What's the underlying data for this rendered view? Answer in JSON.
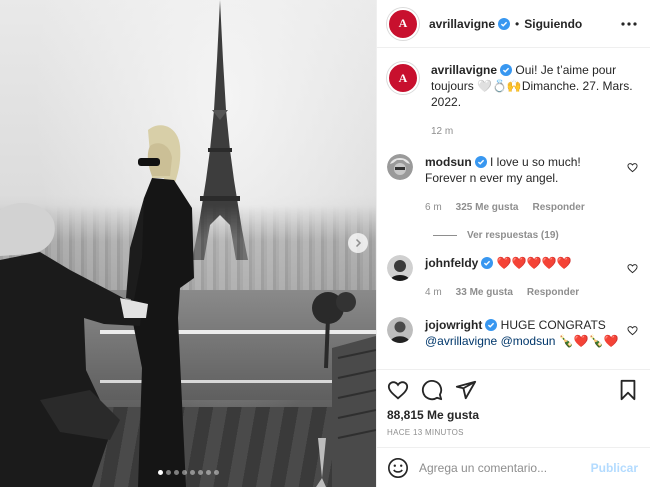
{
  "post": {
    "author": "avrillavigne",
    "follow_state": "Siguiendo",
    "separator": "•",
    "brand_color": "#c8102e",
    "link_color": "#00376b",
    "photo_count": 8,
    "active_photo": 1
  },
  "caption": {
    "username": "avrillavigne",
    "text": "Oui! Je t’aime pour toujours 🤍💍🙌Dimanche. 27. Mars. 2022.",
    "time": "12 m"
  },
  "comments": [
    {
      "username": "modsun",
      "text": "I love u so much! Forever n ever my angel.",
      "time": "6 m",
      "likes": "325 Me gusta",
      "reply": "Responder",
      "view_replies": "Ver respuestas (19)"
    },
    {
      "username": "johnfeldy",
      "text": "❤️❤️❤️❤️❤️",
      "time": "4 m",
      "likes": "33 Me gusta",
      "reply": "Responder"
    },
    {
      "username": "jojowright",
      "text": "HUGE CONGRATS",
      "mention1": "@avrillavigne",
      "mention2": "@modsun",
      "emoji": "🍾❤️🍾❤️"
    }
  ],
  "footer": {
    "likes": "88,815 Me gusta",
    "time_ago": "HACE 13 MINUTOS",
    "comment_placeholder": "Agrega un comentario...",
    "publish_label": "Publicar"
  },
  "icons": {
    "more": "more-options-icon",
    "like": "heart-icon",
    "comment": "comment-icon",
    "share": "share-icon",
    "save": "bookmark-icon",
    "emoji": "emoji-icon",
    "verified": "verified-badge-icon",
    "next": "chevron-right-icon"
  }
}
